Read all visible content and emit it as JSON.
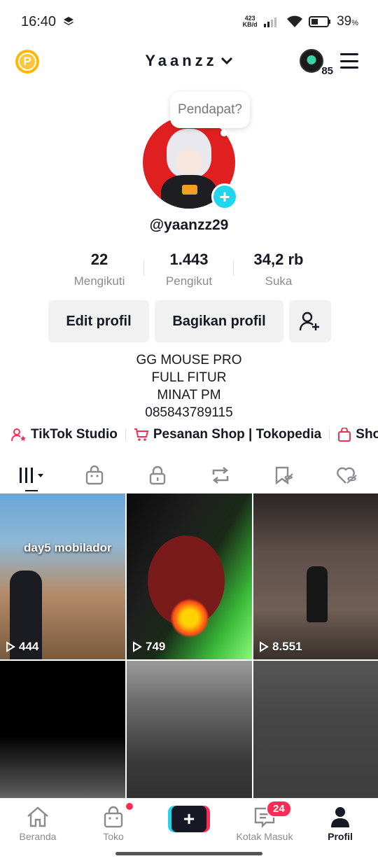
{
  "status_bar": {
    "time": "16:40",
    "net_speed_value": "423",
    "net_speed_unit": "KB/d",
    "battery_percent": "39",
    "battery_unit": "%"
  },
  "top_nav": {
    "account_name": "Yaanzz",
    "friends_count": "85"
  },
  "profile": {
    "bubble_text": "Pendapat?",
    "username": "@yaanzz29",
    "stats": [
      {
        "value": "22",
        "label": "Mengikuti"
      },
      {
        "value": "1.443",
        "label": "Pengikut"
      },
      {
        "value": "34,2 rb",
        "label": "Suka"
      }
    ],
    "edit_label": "Edit profil",
    "share_label": "Bagikan profil",
    "bio_lines": [
      "GG MOUSE PRO",
      "FULL FITUR",
      "MINAT PM",
      "085843789115"
    ]
  },
  "quick_links": [
    {
      "label": "TikTok Studio",
      "icon": "person-star-icon"
    },
    {
      "label": "Pesanan Shop | Tokopedia",
      "icon": "cart-icon"
    },
    {
      "label": "Sho",
      "icon": "bag-icon"
    }
  ],
  "tabs": [
    "videos-grid-icon",
    "shop-bag-icon",
    "lock-icon",
    "repost-icon",
    "saved-icon",
    "liked-icon"
  ],
  "videos": [
    {
      "views": "444",
      "caption": "day5 mobilador"
    },
    {
      "views": "749"
    },
    {
      "views": "8.551"
    },
    {},
    {},
    {}
  ],
  "bottom_nav": {
    "home": "Beranda",
    "shop": "Toko",
    "inbox": "Kotak Masuk",
    "inbox_badge": "24",
    "profile": "Profil"
  },
  "colors": {
    "accent_red": "#fe2c55",
    "accent_cyan": "#20d5ec",
    "text": "#161823"
  }
}
